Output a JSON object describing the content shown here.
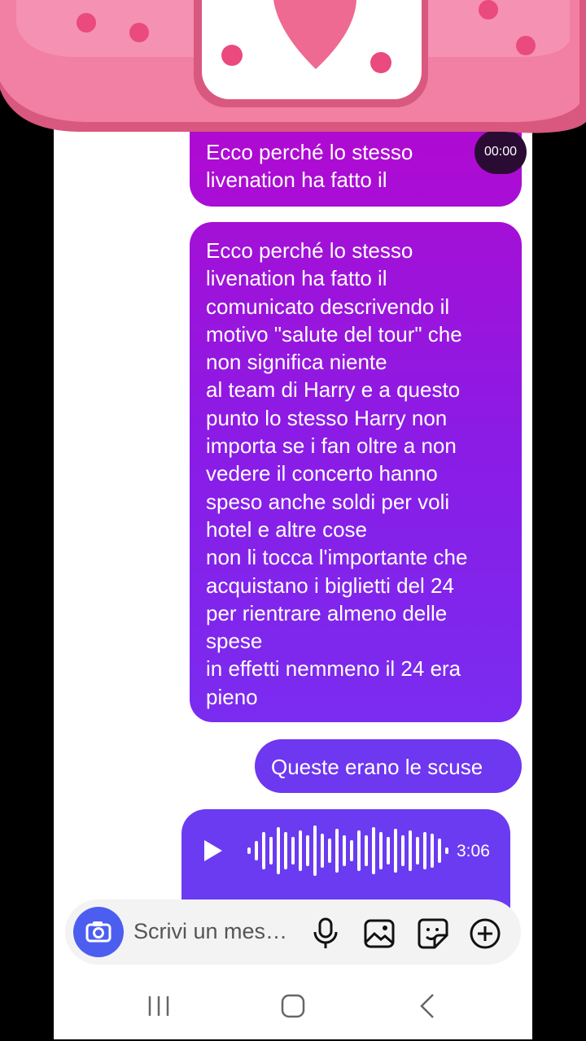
{
  "messages": [
    {
      "text": "Ecco perché lo stesso\nlivenation ha fatto il",
      "timer": "00:00"
    },
    {
      "text": "Ecco perché lo stesso\nlivenation ha fatto il\ncomunicato descrivendo il\nmotivo \"salute del tour\" che\nnon significa niente\nal team di Harry e a questo\npunto lo stesso Harry non\nimporta se i fan oltre a non\nvedere il concerto hanno\nspeso anche soldi per voli\nhotel e altre cose\nnon li tocca l'importante che\nacquistano i biglietti del 24\nper rientrare almeno delle\nspese\nin effetti nemmeno il 24 era\npieno"
    },
    {
      "text": "Queste erano le scuse"
    }
  ],
  "voice_message": {
    "duration": "3:06",
    "icon": "play-icon"
  },
  "composer": {
    "placeholder": "Scrivi un mes…",
    "icons": [
      "camera-icon",
      "microphone-icon",
      "image-icon",
      "sticker-icon",
      "add-icon"
    ]
  },
  "nav_icons": [
    "recent-apps-icon",
    "home-icon",
    "back-icon"
  ],
  "colors": {
    "bubble_top": "#b109d0",
    "bubble_bottom": "#6e37f0",
    "camera": "#4c5ef0",
    "sticker_pink": "#f27fa4"
  }
}
